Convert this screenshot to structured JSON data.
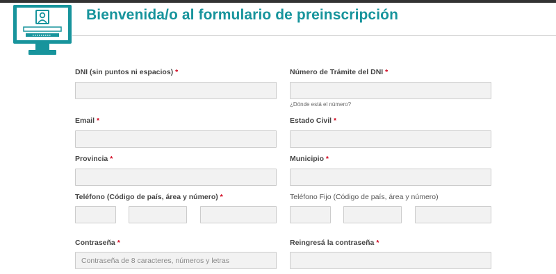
{
  "header": {
    "title": "Bienvenida/o al formulario de preinscripción",
    "logo_icon": "computer-user-icon",
    "accent_color": "#17949c"
  },
  "form": {
    "required_mark": "*",
    "dni": {
      "label": "DNI (sin puntos ni espacios)",
      "value": ""
    },
    "tramite": {
      "label": "Número de Trámite del DNI",
      "value": "",
      "help": "¿Dónde está el número?"
    },
    "email": {
      "label": "Email",
      "value": ""
    },
    "estado_civil": {
      "label": "Estado Civil",
      "value": ""
    },
    "provincia": {
      "label": "Provincia",
      "value": ""
    },
    "municipio": {
      "label": "Municipio",
      "value": ""
    },
    "telefono": {
      "label": "Teléfono (Código de país, área y número)"
    },
    "telefono_fijo": {
      "label": "Teléfono Fijo (Código de país, área y número)"
    },
    "contrasena": {
      "label": "Contraseña",
      "placeholder": "Contraseña de 8 caracteres, números y letras"
    },
    "reingreso": {
      "label": "Reingresá la contraseña",
      "value": ""
    }
  }
}
